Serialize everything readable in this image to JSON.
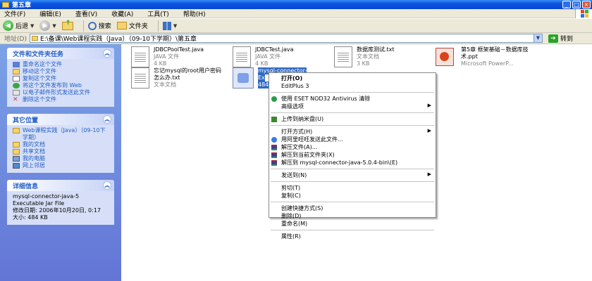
{
  "window": {
    "title": "第五章",
    "buttons": {
      "minimize": "_",
      "maximize": "□",
      "close": "×"
    }
  },
  "menu": [
    "文件(F)",
    "编辑(E)",
    "查看(V)",
    "收藏(A)",
    "工具(T)",
    "帮助(H)"
  ],
  "toolbar": {
    "back_label": "后退",
    "search_label": "搜索",
    "folders_label": "文件夹"
  },
  "address": {
    "label": "地址(D)",
    "path": "E:\\备课\\Web课程实践（Java）（09-10下学期）\\第五章",
    "go_label": "转到"
  },
  "left_pane": {
    "tasks": {
      "title": "文件和文件夹任务",
      "items": [
        "重命名这个文件",
        "移动这个文件",
        "复制这个文件",
        "将这个文件发布到 Web",
        "以电子邮件形式发送此文件",
        "删除这个文件"
      ]
    },
    "places": {
      "title": "其它位置",
      "items": [
        "Web课程实践（Java）（09-10下学期）",
        "我的文档",
        "共享文档",
        "我的电脑",
        "网上邻居"
      ]
    },
    "details": {
      "title": "详细信息",
      "name": "mysql-connector-java-5",
      "type": "Executable Jar File",
      "modified": "修改日期: 2006年10月20日, 0:17",
      "size": "大小: 484 KB"
    }
  },
  "files": [
    {
      "name": "JDBCPoolTest.java",
      "type": "JAVA 文件",
      "size": "4 KB",
      "icon": "text-file-icon"
    },
    {
      "name": "JDBCTest.java",
      "type": "JAVA 文件",
      "size": "4 KB",
      "icon": "text-file-icon"
    },
    {
      "name": "数据库测试.txt",
      "type": "文本文档",
      "size": "3 KB",
      "icon": "text-file-icon"
    },
    {
      "name": "第5章 框架基础－数据库技术.ppt",
      "type": "Microsoft PowerP...",
      "size": "",
      "icon": "ppt-file-icon"
    },
    {
      "name": "忘记mysql的root用户密码怎么办.txt",
      "type": "文本文档",
      "size": "",
      "icon": "text-file-icon"
    },
    {
      "name": "mysql-connector-",
      "type": "Ex",
      "size": "484",
      "icon": "jar-file-icon"
    }
  ],
  "context_menu": {
    "items": [
      {
        "label": "打开(O)",
        "bold": true
      },
      {
        "label": "EditPlus 3"
      },
      {
        "sep": true
      },
      {
        "label": "使用 ESET NOD32 Antivirus 清除",
        "icon": "nod32-icon"
      },
      {
        "label": "高级选项",
        "submenu": true
      },
      {
        "sep": true
      },
      {
        "label": "上传到纳米盘(U)",
        "icon": "upload-icon"
      },
      {
        "sep": true
      },
      {
        "label": "打开方式(H)",
        "submenu": true
      },
      {
        "label": "用阿里旺旺发送此文件...",
        "icon": "aliwangwang-icon"
      },
      {
        "label": "解压文件(A)...",
        "icon": "winrar-icon"
      },
      {
        "label": "解压到当前文件夹(X)",
        "icon": "winrar-icon"
      },
      {
        "label": "解压到 mysql-connector-java-5.0.4-bin\\(E)",
        "icon": "winrar-icon"
      },
      {
        "sep": true
      },
      {
        "label": "发送到(N)",
        "submenu": true
      },
      {
        "sep": true
      },
      {
        "label": "剪切(T)"
      },
      {
        "label": "复制(C)"
      },
      {
        "sep": true
      },
      {
        "label": "创建快捷方式(S)"
      },
      {
        "label": "删除(D)"
      },
      {
        "label": "重命名(M)"
      },
      {
        "sep": true
      },
      {
        "label": "属性(R)"
      }
    ]
  },
  "colors": {
    "titlebar": "#0a54e4",
    "selection": "#316ac5",
    "leftpane": "#6375d6",
    "link": "#215dc6"
  }
}
